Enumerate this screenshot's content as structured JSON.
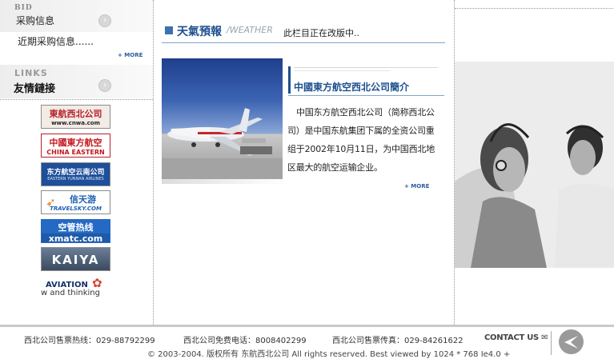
{
  "left": {
    "bid": {
      "title_en": "BID",
      "title_cn": "采购信息",
      "item": "近期采购信息......",
      "more": "+ MORE"
    },
    "links": {
      "title_en": "LINKS",
      "title_cn": "友情鏈接"
    },
    "logos": [
      {
        "name": "cnwa",
        "line1": "東航西北公司",
        "line2": "www.cnwa.com"
      },
      {
        "name": "china-eastern",
        "line1": "中國東方航空",
        "line2": "CHINA EASTERN"
      },
      {
        "name": "yunnan",
        "line1": "东方航空云南公司",
        "line2": "EASTERN YUNNAN AIRLINES"
      },
      {
        "name": "travelsky",
        "line1": "信天游",
        "line2": "TRAVELSKY.COM"
      },
      {
        "name": "xmatc",
        "line1": "空管热线",
        "line2": "xmatc.com"
      },
      {
        "name": "kaiya",
        "line1": "KAIYA",
        "line2": ""
      },
      {
        "name": "aviation",
        "line1": "AVIATION",
        "line2": "w and thinking"
      }
    ]
  },
  "mid": {
    "weather": {
      "title_cn": "天氣預報",
      "title_en": "WEATHER",
      "notice": "此栏目正在改版中.."
    },
    "company": {
      "title": "中國東方航空西北公司簡介",
      "body": "中国东方航空西北公司（简称西北公司）是中国东航集团下属的全资公司重组于2002年10月11日，为中国西北地区最大的航空运输企业。",
      "more": "+ MORE"
    }
  },
  "footer": {
    "hotline": "西北公司售票热线：029-88792299",
    "free": "西北公司免费电话：8008402299",
    "fax": "西北公司售票传真：029-84261622",
    "contact": "CONTACT US",
    "copyright": "© 2003-2004. 版权所有 东航西北公司 All rights reserved. Best viewed by 1024 * 768 Ie4.0 +"
  },
  "colors": {
    "accent": "#1d4f8f",
    "border": "#9a9a9a"
  }
}
